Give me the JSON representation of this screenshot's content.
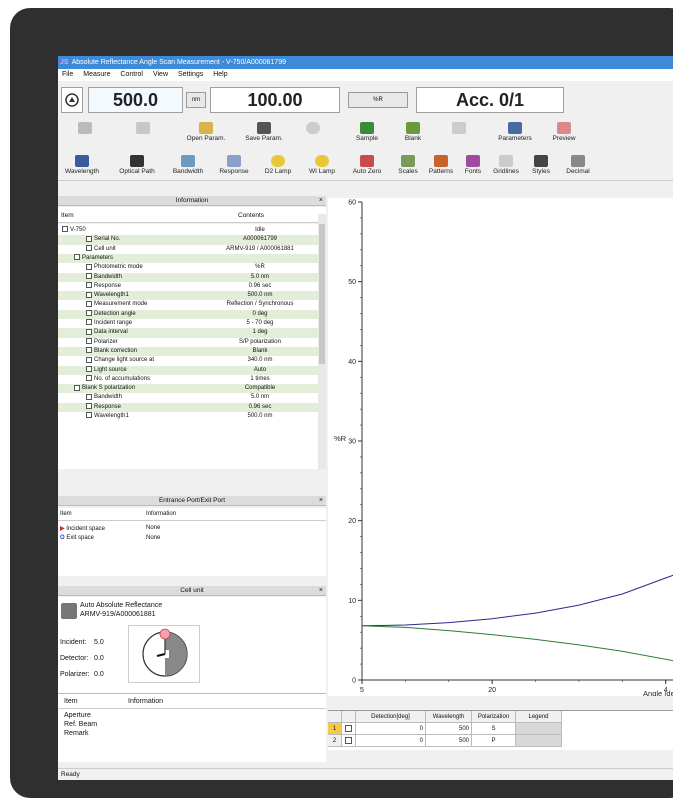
{
  "window": {
    "title": "Absolute Reflectance Angle Scan Measurement - V-750/A000061799"
  },
  "menu": [
    "File",
    "Measure",
    "Control",
    "View",
    "Settings",
    "Help"
  ],
  "readout": {
    "wavelength": "500.0",
    "wavelength_unit": "nm",
    "value": "100.00",
    "value_unit": "%R",
    "accumulation": "Acc. 0/1"
  },
  "toolbar1": [
    {
      "label": "",
      "icon": "disk-icon",
      "enabled": false
    },
    {
      "label": "",
      "icon": "calc-icon",
      "enabled": false
    },
    {
      "label": "Open Param.",
      "icon": "open-folder-icon",
      "enabled": true
    },
    {
      "label": "Save Param.",
      "icon": "save-disk-icon",
      "enabled": true
    },
    {
      "label": "",
      "icon": "cancel-icon",
      "enabled": false
    },
    {
      "label": "Sample",
      "icon": "sample-icon",
      "enabled": true
    },
    {
      "label": "Blank",
      "icon": "blank-icon",
      "enabled": true
    },
    {
      "label": "",
      "icon": "print-icon",
      "enabled": false
    },
    {
      "label": "Parameters",
      "icon": "parameters-icon",
      "enabled": true
    },
    {
      "label": "Preview",
      "icon": "preview-icon",
      "enabled": true
    }
  ],
  "toolbar2": [
    "Wavelength",
    "Optical Path",
    "Bandwidth",
    "Response",
    "D2 Lamp",
    "WI Lamp",
    "Auto Zero",
    "Scales",
    "Patterns",
    "Fonts",
    "Gridlines",
    "Styles",
    "Decimal"
  ],
  "information": {
    "title": "Information",
    "col_item": "Item",
    "col_contents": "Contents",
    "rows": [
      {
        "name": "V-750",
        "value": "Idle",
        "indent": 0
      },
      {
        "name": "Serial No.",
        "value": "A000061799",
        "indent": 2
      },
      {
        "name": "Cell unit",
        "value": "ARMV-919 / A000061881",
        "indent": 2
      },
      {
        "name": "Parameters",
        "value": "",
        "indent": 1
      },
      {
        "name": "Photometric mode",
        "value": "%R",
        "indent": 2
      },
      {
        "name": "Bandwidth",
        "value": "5.0 nm",
        "indent": 2
      },
      {
        "name": "Response",
        "value": "0.96 sec",
        "indent": 2
      },
      {
        "name": "Wavelength1",
        "value": "500.0 nm",
        "indent": 2
      },
      {
        "name": "Measurement mode",
        "value": "Reflection / Synchronous",
        "indent": 2
      },
      {
        "name": "Detection angle",
        "value": "0 deg",
        "indent": 2
      },
      {
        "name": "Incident range",
        "value": "5 - 70 deg",
        "indent": 2
      },
      {
        "name": "Data interval",
        "value": "1 deg",
        "indent": 2
      },
      {
        "name": "Polarizer",
        "value": "S/P polarization",
        "indent": 2
      },
      {
        "name": "Blank correction",
        "value": "Blank",
        "indent": 2
      },
      {
        "name": "Change light source at",
        "value": "340.0 nm",
        "indent": 2
      },
      {
        "name": "Light source",
        "value": "Auto",
        "indent": 2
      },
      {
        "name": "No. of accumulations",
        "value": "1 times",
        "indent": 2
      },
      {
        "name": "Blank S polarization",
        "value": "Compatible",
        "indent": 1
      },
      {
        "name": "Bandwidth",
        "value": "5.0 nm",
        "indent": 2
      },
      {
        "name": "Response",
        "value": "0.96 sec",
        "indent": 2
      },
      {
        "name": "Wavelength1",
        "value": "500.0 nm",
        "indent": 2
      }
    ]
  },
  "ports": {
    "title": "Entrance Port/Exit Port",
    "col_item": "Item",
    "col_info": "Information",
    "rows": [
      {
        "name": "Incident space",
        "value": "None"
      },
      {
        "name": "Exit space",
        "value": "None"
      }
    ]
  },
  "cell": {
    "title": "Cell unit",
    "name_line1": "Auto Absolute Reflectance",
    "name_line2": "ARMV-919/A000061881",
    "incident_label": "Incident:",
    "incident_value": "5.0",
    "detector_label": "Detector:",
    "detector_value": "0.0",
    "polarizer_label": "Polarizer:",
    "polarizer_value": "0.0",
    "col_item": "Item",
    "col_info": "Information",
    "rows": [
      "Aperture",
      "Ref. Beam",
      "Remark"
    ]
  },
  "chart_data": {
    "type": "line",
    "xlabel": "Angle [deg]",
    "ylabel": "%R",
    "xlim": [
      5,
      42
    ],
    "ylim": [
      0,
      60
    ],
    "yticks": [
      0,
      10,
      20,
      30,
      40,
      50,
      60
    ],
    "xticks": [
      5,
      20,
      40
    ],
    "xtick_labels": [
      "5",
      "20",
      "4"
    ],
    "series": [
      {
        "x": [
          5,
          10,
          15,
          20,
          25,
          30,
          35,
          40,
          42
        ],
        "y": [
          6.8,
          6.9,
          7.2,
          7.7,
          8.4,
          9.4,
          10.8,
          12.8,
          13.6
        ],
        "color": "#2a2a8c"
      },
      {
        "x": [
          5,
          10,
          15,
          20,
          25,
          30,
          35,
          40,
          42
        ],
        "y": [
          6.8,
          6.6,
          6.2,
          5.7,
          5.1,
          4.4,
          3.6,
          2.6,
          2.2
        ],
        "color": "#2e7d32"
      }
    ]
  },
  "datagrid": {
    "headers": [
      "Detection[deg]",
      "Wavelength",
      "Polarization",
      "Legend"
    ],
    "rows": [
      {
        "index": "1",
        "detection": "0",
        "wavelength": "500",
        "polarization": "S"
      },
      {
        "index": "2",
        "detection": "0",
        "wavelength": "500",
        "polarization": "P"
      }
    ]
  },
  "status": "Ready",
  "colors": {
    "titlebar": "#3c8ad8",
    "row_highlight": "#e3eed9",
    "grid_row_selected": "#f7c948"
  }
}
